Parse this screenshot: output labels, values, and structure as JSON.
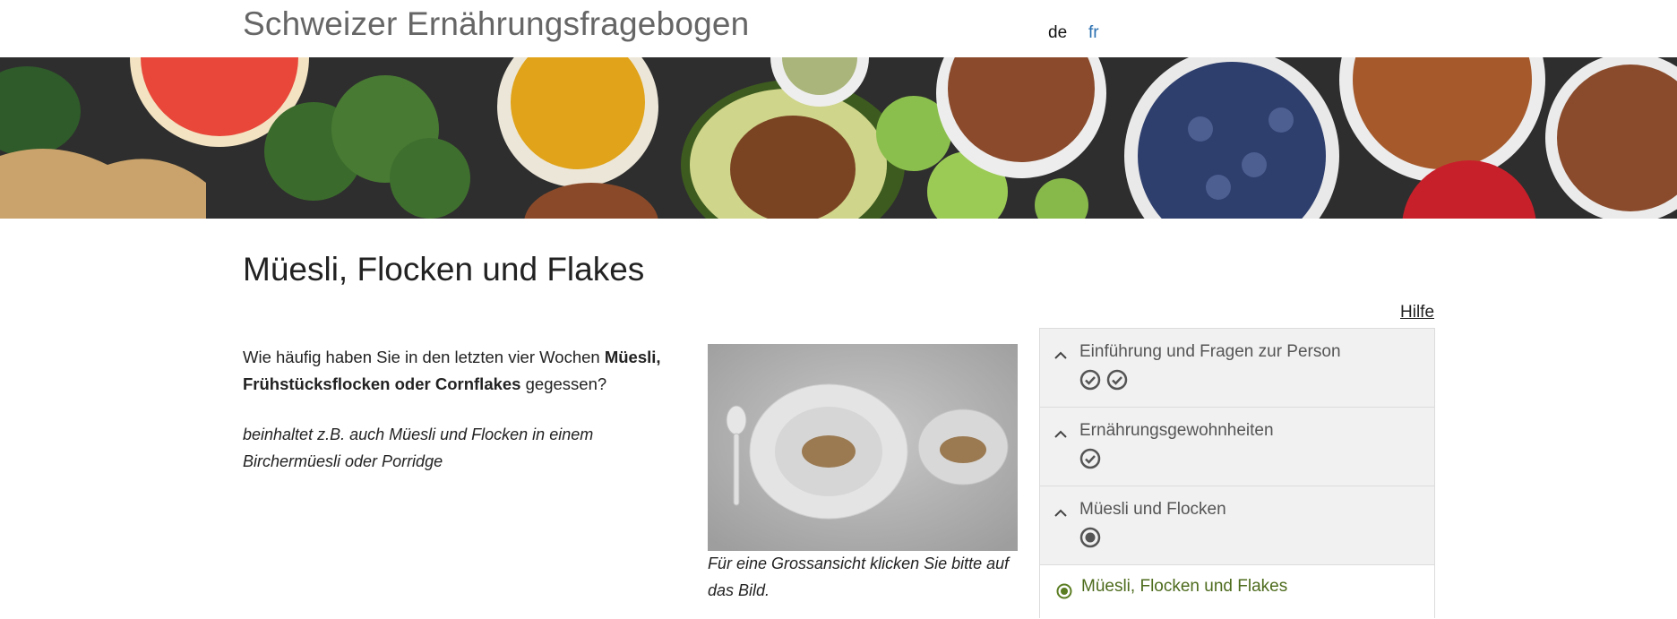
{
  "header": {
    "title": "Schweizer Ernährungsfragebogen",
    "languages": [
      {
        "label": "de",
        "active": true
      },
      {
        "label": "fr",
        "active": false
      }
    ]
  },
  "hero": {
    "icon": "food-banner-image"
  },
  "main": {
    "page_title": "Müesli, Flocken und Flakes",
    "help_label": "Hilfe",
    "question": {
      "prefix": "Wie häufig haben Sie in den letzten vier Wochen ",
      "bold": "Müesli, Frühstücksflocken oder Cornflakes",
      "suffix": " gegessen?"
    },
    "hint": "beinhaltet z.B. auch Müesli und Flocken in einem Birchermüesli oder Porridge",
    "image_caption": "Für eine Grossansicht klicken Sie bitte auf das Bild."
  },
  "nav": {
    "sections": [
      {
        "label": "Einführung und Fragen zur Person",
        "status": [
          "check-circle-icon",
          "check-circle-icon"
        ]
      },
      {
        "label": "Ernährungsgewohnheiten",
        "status": [
          "check-circle-icon"
        ]
      },
      {
        "label": "Müesli und Flocken",
        "status": [
          "target-circle-icon"
        ]
      }
    ],
    "current_item": "Müesli, Flocken und Flakes"
  },
  "colors": {
    "title_gray": "#666666",
    "link_blue": "#2a6fb0",
    "nav_bg": "#f1f1f1",
    "current_green": "#4d6b1d"
  }
}
